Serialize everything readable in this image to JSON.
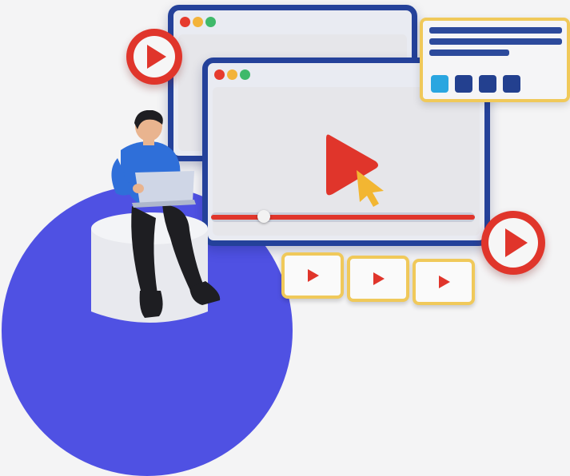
{
  "illustration": {
    "subject": "video-streaming",
    "icons": [
      "play-icon",
      "cursor-icon"
    ],
    "colors": {
      "background": "#f4f4f5",
      "circle": "#4f51e3",
      "window_frame": "#24419a",
      "window_bar": "#e9ebf2",
      "window_body": "#e6e6ea",
      "play_red": "#e0352b",
      "cursor_yellow": "#f2b632",
      "card_border": "#f0c95a",
      "dot_red": "#e63b2e",
      "dot_yellow": "#f3b33a",
      "dot_green": "#3fb96a",
      "line_blue": "#2c4a9c",
      "square_cyan": "#2aa6e0",
      "square_navy": "#23408f",
      "shirt": "#2f6fd9",
      "pants": "#1e1e22",
      "skin": "#e9b48f",
      "laptop": "#cfd6e6",
      "stool": "#e8e9ee"
    },
    "progress": {
      "fraction": 0.2
    },
    "thumbnail_count": 3,
    "card_square_count": 4
  }
}
